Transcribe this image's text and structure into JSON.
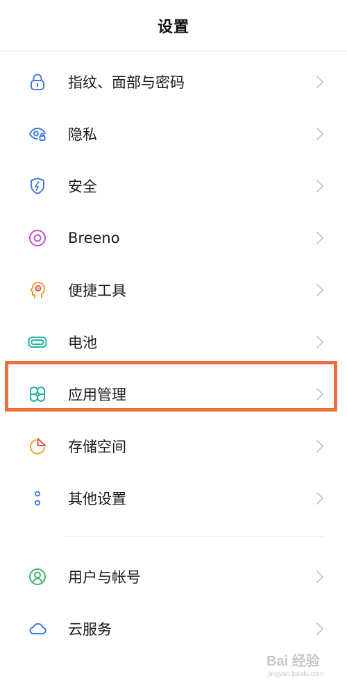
{
  "header": {
    "title": "设置"
  },
  "items": [
    {
      "label": "指纹、面部与密码",
      "icon": "lock-icon",
      "color": "#3f7be0"
    },
    {
      "label": "隐私",
      "icon": "privacy-eye-icon",
      "color": "#3f7be0"
    },
    {
      "label": "安全",
      "icon": "shield-bolt-icon",
      "color": "#3f7be0"
    },
    {
      "label": "Breeno",
      "icon": "breeno-icon",
      "color": "#c44fc8"
    },
    {
      "label": "便捷工具",
      "icon": "head-tool-icon",
      "color": "#f0a02d"
    },
    {
      "label": "电池",
      "icon": "battery-icon",
      "color": "#22b3a0"
    },
    {
      "label": "应用管理",
      "icon": "apps-grid-icon",
      "color": "#22b3a0"
    },
    {
      "label": "存储空间",
      "icon": "pie-chart-icon",
      "color": "#f0a02d"
    },
    {
      "label": "其他设置",
      "icon": "more-dots-icon",
      "color": "#3f7be0"
    },
    {
      "label": "用户与帐号",
      "icon": "user-icon",
      "color": "#3cb56a"
    },
    {
      "label": "云服务",
      "icon": "cloud-icon",
      "color": "#3f7be0"
    }
  ],
  "highlight_color": "#ef6f3c",
  "watermark": {
    "text": "Bai 经验",
    "sub": "jingyan.baidu.com"
  }
}
